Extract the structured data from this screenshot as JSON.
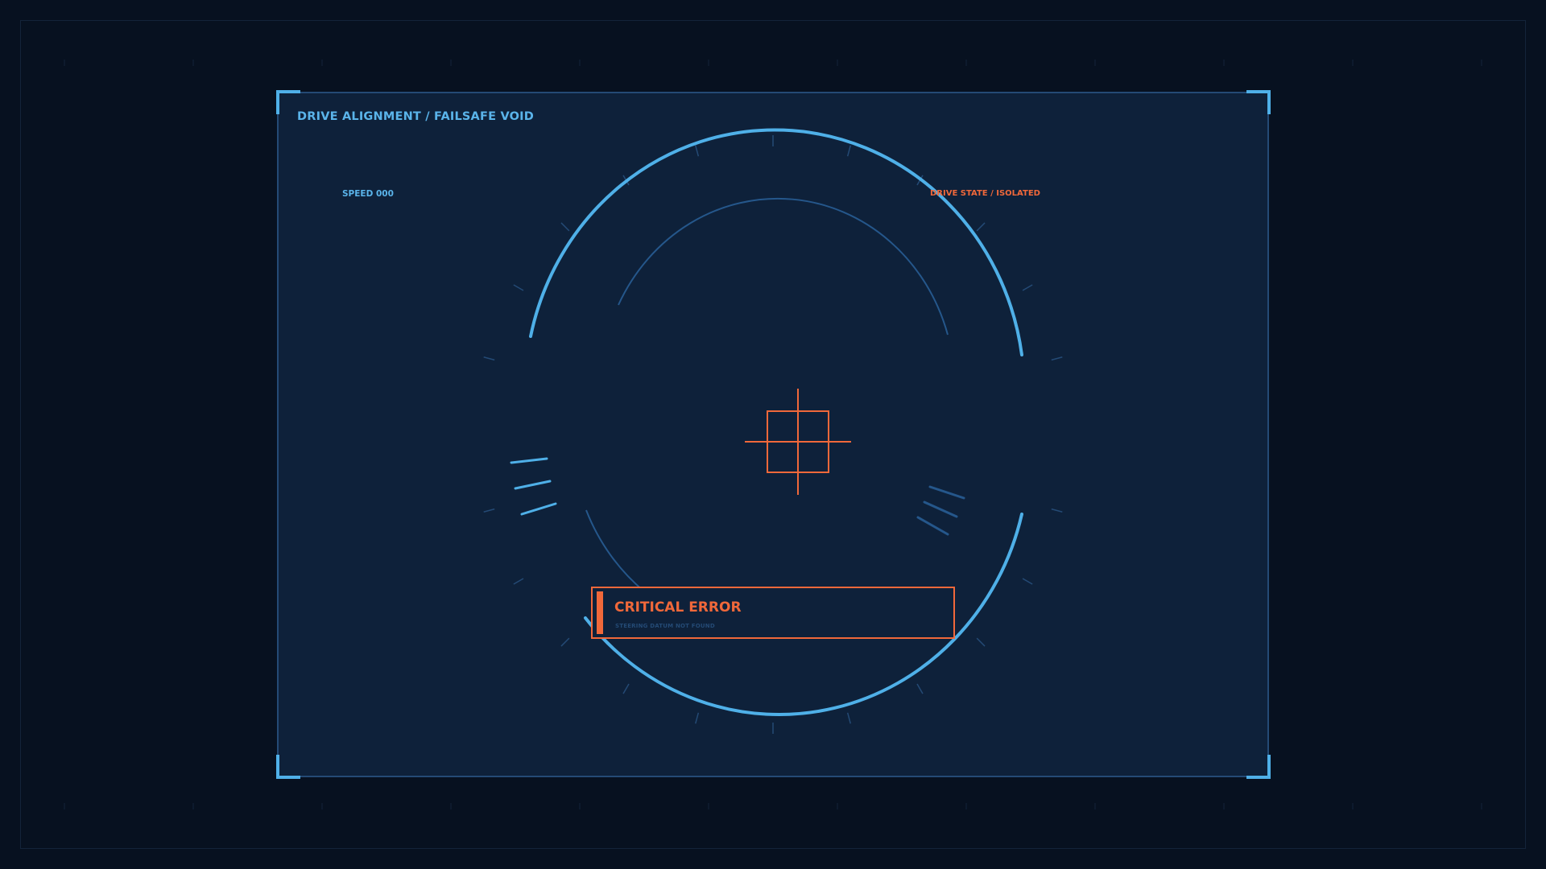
{
  "panel": {
    "title": "DRIVE ALIGNMENT / FAILSAFE VOID",
    "speed_label": "SPEED 000",
    "drive_state_label": "DRIVE STATE / ISOLATED"
  },
  "alert": {
    "title": "CRITICAL ERROR",
    "message": "STEERING DATUM NOT FOUND"
  },
  "icons": {
    "reticle": "crosshair-icon"
  },
  "colors": {
    "background": "#071120",
    "panel": "#0e213a",
    "accent_blue": "#5ab4ea",
    "dim_blue": "#244a75",
    "alert_orange": "#f0683a"
  }
}
